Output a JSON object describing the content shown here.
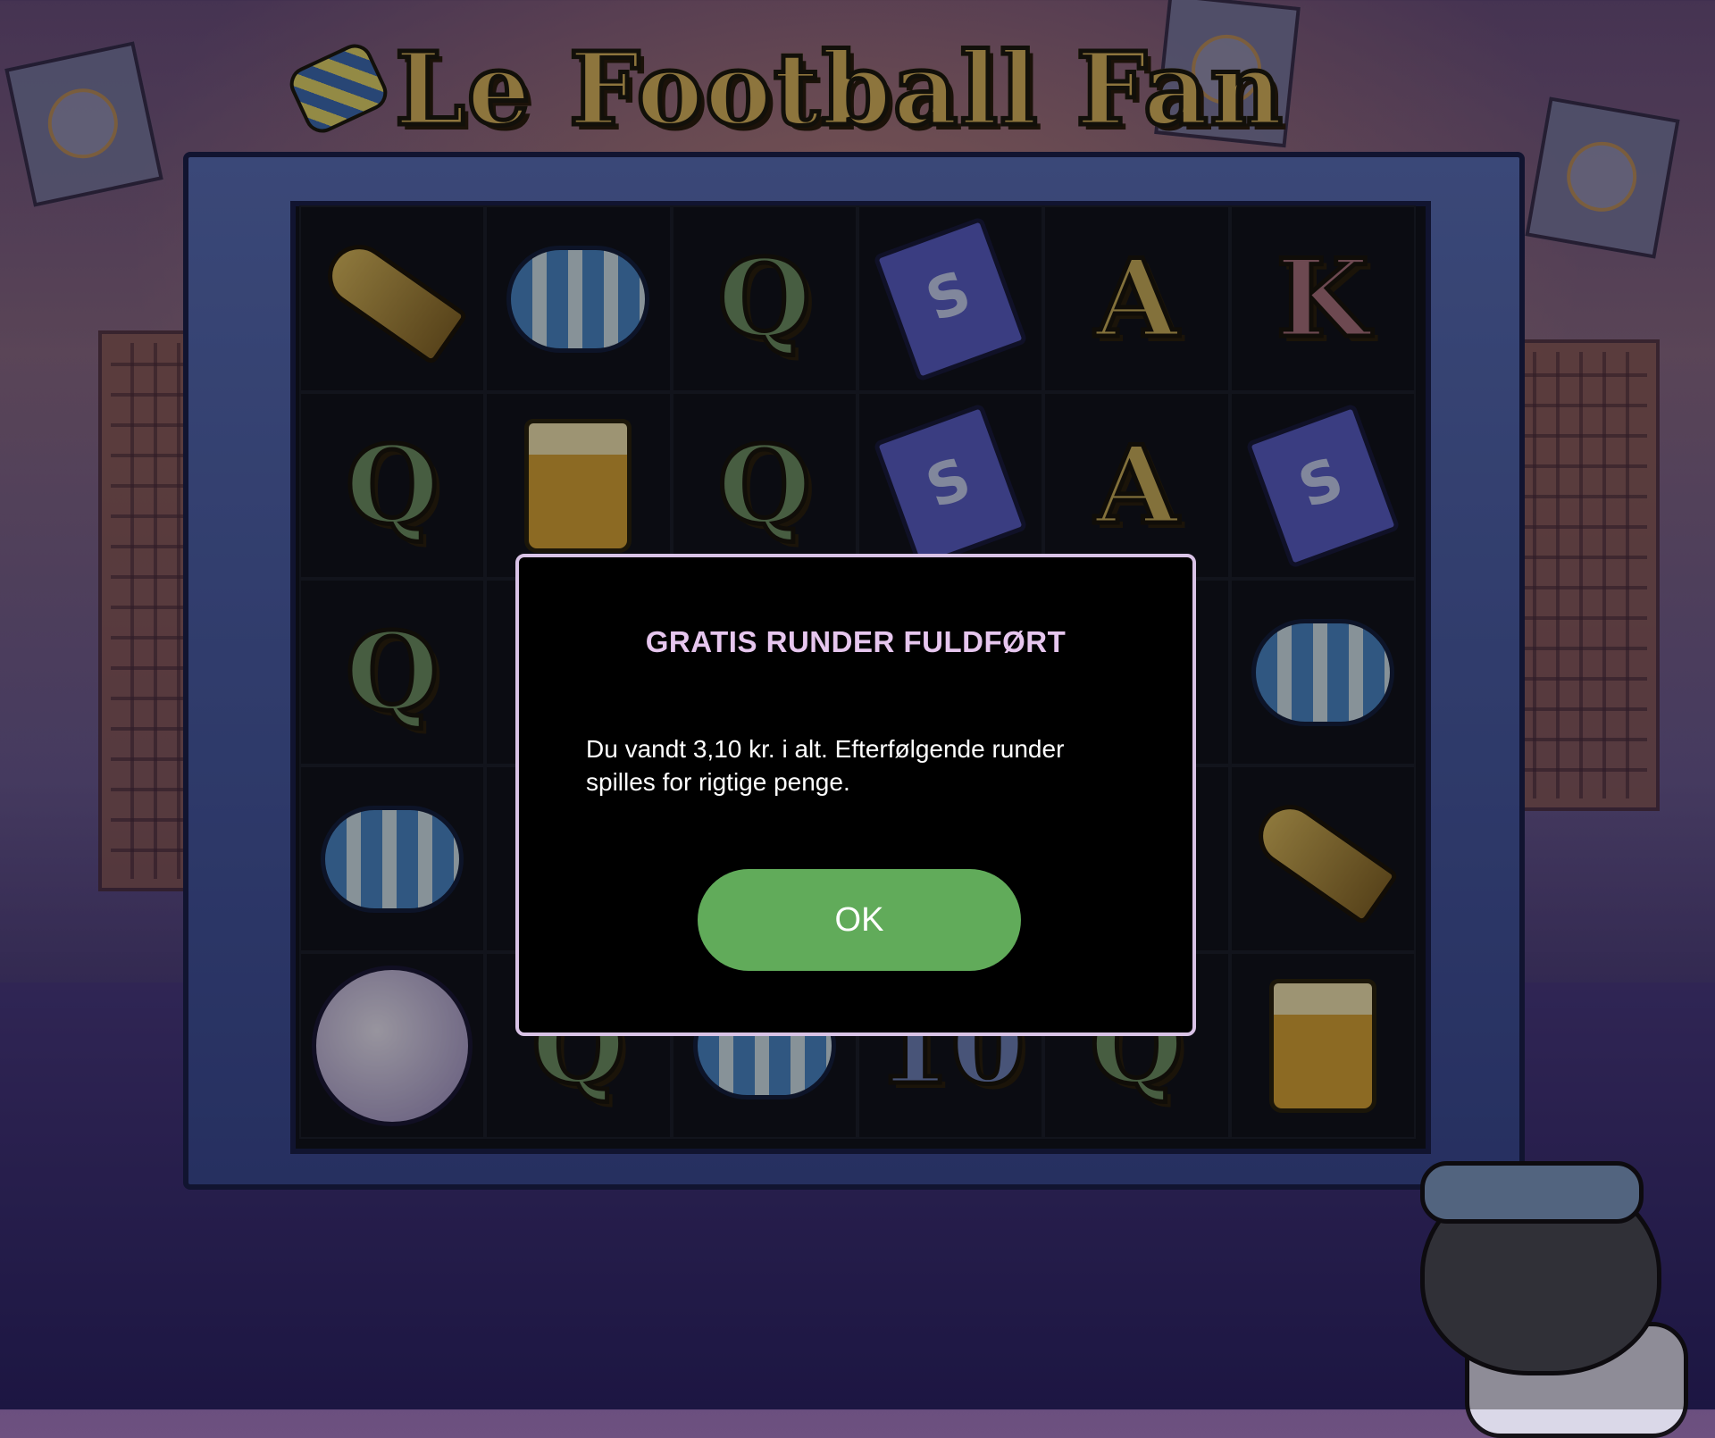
{
  "game": {
    "title": "Le Football Fan"
  },
  "reels": {
    "rows": [
      [
        "horn",
        "scarf",
        "Q",
        "ticket",
        "A",
        "K"
      ],
      [
        "Q",
        "beer",
        "Q",
        "ticket",
        "A",
        "ticket"
      ],
      [
        "Q",
        "",
        "",
        "",
        "",
        "scarf"
      ],
      [
        "scarf",
        "",
        "",
        "",
        "",
        "horn"
      ],
      [
        "ball",
        "Q",
        "scarf",
        "10",
        "Q",
        "beer"
      ]
    ]
  },
  "dialog": {
    "title": "GRATIS RUNDER FULDFØRT",
    "message": "Du vandt 3,10 kr. i alt. Efterfølgende runder spilles for rigtige penge.",
    "ok_label": "OK"
  },
  "colors": {
    "ok_button": "#61ab5a",
    "dialog_border": "#d9c3e6",
    "dialog_title": "#e6c6ee"
  }
}
